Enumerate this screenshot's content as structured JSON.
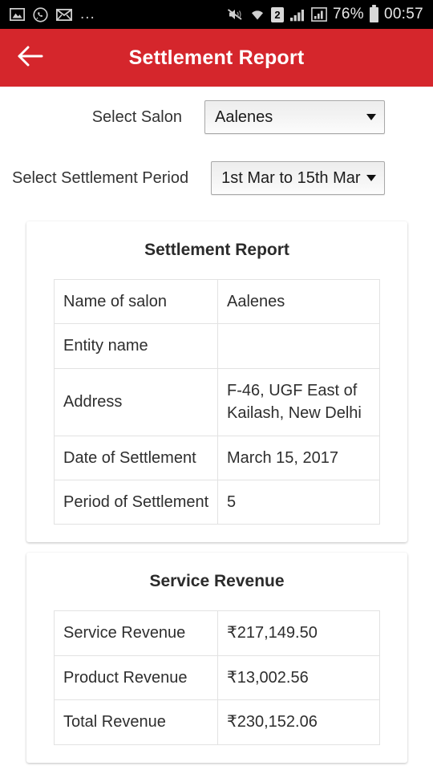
{
  "status_bar": {
    "left_icons": [
      "image-icon",
      "whatsapp-icon",
      "mail-icon",
      "overflow-dots-icon"
    ],
    "dots": "...",
    "right_icons": [
      "mute-icon",
      "wifi-icon",
      "sim2-icon",
      "signal-icon",
      "signal-2-icon",
      "battery-icon"
    ],
    "sim_label": "2",
    "battery_percent": "76%",
    "time": "00:57"
  },
  "appbar": {
    "title": "Settlement Report",
    "back_icon": "arrow-left-icon",
    "color": "#d5262c"
  },
  "form": {
    "salon": {
      "label": "Select Salon",
      "value": "Aalenes"
    },
    "period": {
      "label": "Select Settlement Period",
      "value": "1st Mar to 15th Mar"
    }
  },
  "cards": [
    {
      "title": "Settlement Report",
      "rows": [
        {
          "key": "Name of salon",
          "value": "Aalenes"
        },
        {
          "key": "Entity name",
          "value": ""
        },
        {
          "key": "Address",
          "value": "F-46, UGF East of Kailash, New Delhi"
        },
        {
          "key": "Date of Settlement",
          "value": "March 15, 2017"
        },
        {
          "key": "Period of Settlement",
          "value": "5"
        }
      ]
    },
    {
      "title": "Service Revenue",
      "rows": [
        {
          "key": "Service Revenue",
          "value": "₹217,149.50"
        },
        {
          "key": "Product Revenue",
          "value": "₹13,002.56"
        },
        {
          "key": "Total Revenue",
          "value": "₹230,152.06"
        }
      ]
    }
  ]
}
